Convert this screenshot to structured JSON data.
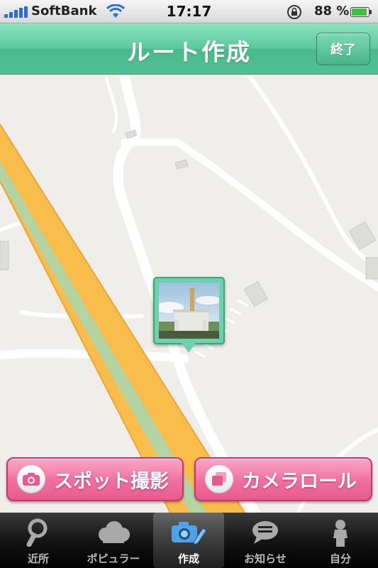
{
  "status_bar": {
    "carrier": "SoftBank",
    "time": "17:17",
    "battery_percent": "88 %",
    "icons": [
      "signal-bars-icon",
      "wifi-icon",
      "rotation-lock-icon",
      "battery-icon"
    ]
  },
  "navbar": {
    "title": "ルート作成",
    "done_label": "終了"
  },
  "map": {
    "pin_icon": "photo-pin",
    "colors": {
      "highway": "#f9bd4c",
      "median": "#b5d4a4",
      "road": "#ffffff",
      "land": "#efeeea"
    }
  },
  "actions": {
    "spot_label": "スポット撮影",
    "spot_icon": "camera-icon",
    "roll_label": "カメラロール",
    "roll_icon": "photo-stack-icon"
  },
  "tabs": [
    {
      "label": "近所",
      "icon": "search-icon",
      "active": false
    },
    {
      "label": "ポピュラー",
      "icon": "cloud-icon",
      "active": false
    },
    {
      "label": "作成",
      "icon": "camera-edit-icon",
      "active": true
    },
    {
      "label": "お知らせ",
      "icon": "speech-bubble-icon",
      "active": false
    },
    {
      "label": "自分",
      "icon": "person-icon",
      "active": false
    }
  ],
  "colors": {
    "accent_green": "#5ac79d",
    "accent_pink": "#ef6f9f"
  }
}
